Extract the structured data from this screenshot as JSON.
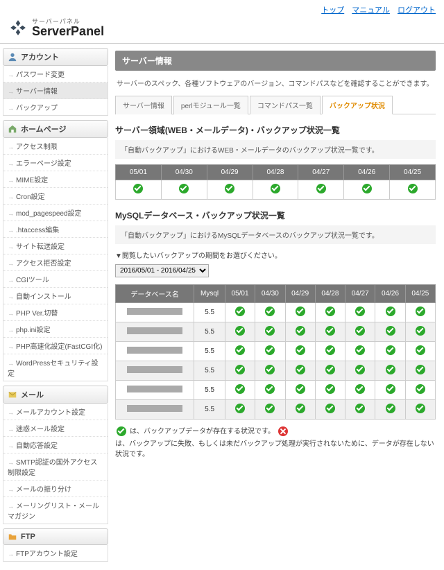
{
  "topnav": {
    "top": "トップ",
    "manual": "マニュアル",
    "logout": "ログアウト"
  },
  "logo": {
    "sub": "サーバーパネル",
    "main": "ServerPanel"
  },
  "sidebar": {
    "account": {
      "label": "アカウント",
      "items": [
        "パスワード変更",
        "サーバー情報",
        "バックアップ"
      ],
      "activeIndex": 1
    },
    "homepage": {
      "label": "ホームページ",
      "items": [
        "アクセス制限",
        "エラーページ設定",
        "MIME設定",
        "Cron設定",
        "mod_pagespeed設定",
        ".htaccess編集",
        "サイト転送設定",
        "アクセス拒否設定",
        "CGIツール",
        "自動インストール",
        "PHP Ver.切替",
        "php.ini設定",
        "PHP高速化設定(FastCGI化)",
        "WordPressセキュリティ設定"
      ]
    },
    "mail": {
      "label": "メール",
      "items": [
        "メールアカウント設定",
        "迷惑メール設定",
        "自動応答設定",
        "SMTP認証の国外アクセス制限設定",
        "メールの振り分け",
        "メーリングリスト・メールマガジン"
      ]
    },
    "ftp": {
      "label": "FTP",
      "items": [
        "FTPアカウント設定"
      ]
    }
  },
  "page": {
    "title": "サーバー情報",
    "desc": "サーバーのスペック、各種ソフトウェアのバージョン、コマンドパスなどを確認することができます。"
  },
  "tabs": [
    "サーバー情報",
    "perlモジュール一覧",
    "コマンドパス一覧",
    "バックアップ状況"
  ],
  "tabActive": 3,
  "section1": {
    "title": "サーバー領域(WEB・メールデータ)・バックアップ状況一覧",
    "desc": "「自動バックアップ」におけるWEB・メールデータのバックアップ状況一覧です。",
    "dates": [
      "05/01",
      "04/30",
      "04/29",
      "04/28",
      "04/27",
      "04/26",
      "04/25"
    ],
    "row": [
      true,
      true,
      true,
      true,
      true,
      true,
      true
    ]
  },
  "section2": {
    "title": "MySQLデータベース・バックアップ状況一覧",
    "desc": "「自動バックアップ」におけるMySQLデータベースのバックアップ状況一覧です。",
    "note": "▼閲覧したいバックアップの期間をお選びください。",
    "selectValue": "2016/05/01 - 2016/04/25",
    "headers": [
      "データベース名",
      "Mysql",
      "05/01",
      "04/30",
      "04/29",
      "04/28",
      "04/27",
      "04/26",
      "04/25"
    ],
    "rows": [
      {
        "mysql": "5.5",
        "cells": [
          true,
          true,
          true,
          true,
          true,
          true,
          true
        ]
      },
      {
        "mysql": "5.5",
        "cells": [
          true,
          true,
          true,
          true,
          true,
          true,
          true
        ]
      },
      {
        "mysql": "5.5",
        "cells": [
          true,
          true,
          true,
          true,
          true,
          true,
          true
        ]
      },
      {
        "mysql": "5.5",
        "cells": [
          true,
          true,
          true,
          true,
          true,
          true,
          true
        ]
      },
      {
        "mysql": "5.5",
        "cells": [
          true,
          true,
          true,
          true,
          true,
          true,
          true
        ]
      },
      {
        "mysql": "5.5",
        "cells": [
          true,
          true,
          true,
          true,
          true,
          true,
          true
        ]
      }
    ]
  },
  "legend": {
    "ok": "は、バックアップデータが存在する状況です。",
    "ng": "は、バックアップに失敗、もしくは未だバックアップ処理が実行されないために、データが存在しない状況です。"
  }
}
